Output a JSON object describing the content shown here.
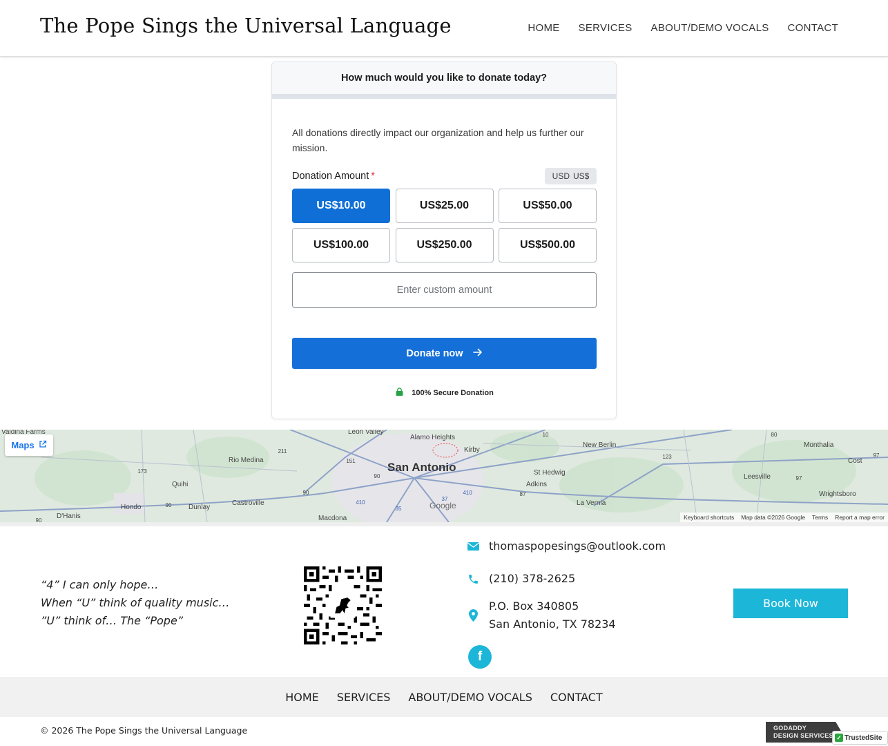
{
  "header": {
    "title": "The Pope Sings the Universal Language",
    "nav": [
      "HOME",
      "SERVICES",
      "ABOUT/DEMO VOCALS",
      "CONTACT"
    ]
  },
  "donation": {
    "question": "How much would you like to donate today?",
    "intro": "All donations directly impact our organization and help us further our mission.",
    "amount_label": "Donation Amount",
    "required_mark": "*",
    "currency_code": "USD",
    "currency_symbol": "US$",
    "amounts": [
      "US$10.00",
      "US$25.00",
      "US$50.00",
      "US$100.00",
      "US$250.00",
      "US$500.00"
    ],
    "selected_amount": "US$10.00",
    "custom_placeholder": "Enter custom amount",
    "custom_value": "",
    "donate_label": "Donate now",
    "secure_label": "100% Secure Donation",
    "accent_color": "#1470d8"
  },
  "map": {
    "button": "Maps",
    "places": [
      "Valdina Farms",
      "Leon Valley",
      "Alamo Heights",
      "New Berlin",
      "Monthalia",
      "Rio Medina",
      "Kirby",
      "Cost",
      "San Antonio",
      "St Hedwig",
      "Quihi",
      "Leesville",
      "Adkins",
      "Wrightsboro",
      "Hondo",
      "Dunlay",
      "Castroville",
      "La Vernia",
      "D'Hanis",
      "Macdona"
    ],
    "highways": [
      "211",
      "151",
      "10",
      "80",
      "123",
      "97",
      "173",
      "90",
      "90",
      "90",
      "87",
      "97",
      "410",
      "37",
      "410",
      "35",
      "90"
    ],
    "attribution": [
      "Keyboard shortcuts",
      "Map data ©2026 Google",
      "Terms",
      "Report a map error"
    ],
    "logo": "Google"
  },
  "footer": {
    "quote_lines": [
      "“4” I can only hope…",
      "When “U” think of quality music…",
      "”U” think of… The “Pope”"
    ],
    "email": "thomaspopesings@outlook.com",
    "phone": "(210) 378-2625",
    "address_line1": "P.O. Box 340805",
    "address_line2": "San Antonio, TX 78234",
    "social": "f",
    "book_label": "Book Now",
    "accent_color": "#1cb6d8",
    "nav": [
      "HOME",
      "SERVICES",
      "ABOUT/DEMO VOCALS",
      "CONTACT"
    ],
    "copyright": "© 2026 The Pope Sings the Universal Language",
    "badge_line1": "GODADDY",
    "badge_line2": "DESIGN SERVICES",
    "trusted_label": "TrustedSite",
    "trusted_mark": "✓"
  }
}
